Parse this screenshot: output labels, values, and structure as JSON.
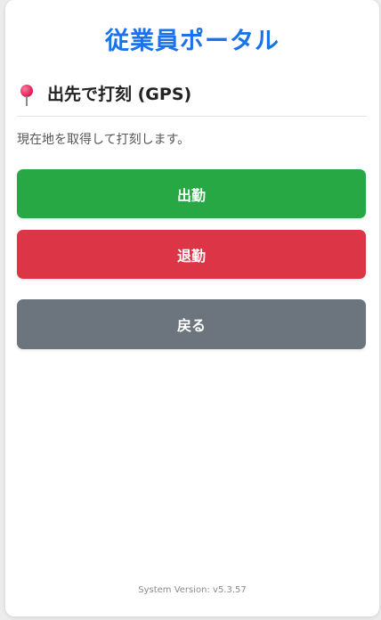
{
  "app": {
    "title": "従業員ポータル"
  },
  "section": {
    "icon": "round-pushpin-icon",
    "title": "出先で打刻 (GPS)",
    "description": "現在地を取得して打刻します。"
  },
  "buttons": {
    "clock_in": "出勤",
    "clock_out": "退勤",
    "back": "戻る"
  },
  "footer": {
    "version": "System Version: v5.3.57"
  },
  "colors": {
    "title": "#1a73e8",
    "clock_in": "#28a745",
    "clock_out": "#dc3545",
    "back": "#6c757d"
  }
}
